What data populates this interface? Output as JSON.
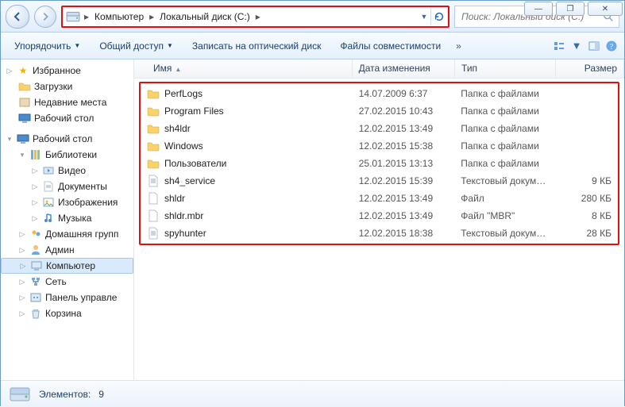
{
  "window_controls": {
    "min": "—",
    "max": "❐",
    "close": "✕"
  },
  "address": {
    "segments": [
      "Компьютер",
      "Локальный диск (C:)"
    ],
    "refresh_title": "Обновить"
  },
  "search": {
    "placeholder": "Поиск: Локальный диск (C:)"
  },
  "commands": {
    "organize": "Упорядочить",
    "share": "Общий доступ",
    "burn": "Записать на оптический диск",
    "compat": "Файлы совместимости"
  },
  "tree": {
    "fav": "Избранное",
    "fav_items": [
      "Загрузки",
      "Недавние места",
      "Рабочий стол"
    ],
    "desktop": "Рабочий стол",
    "libraries": "Библиотеки",
    "lib_items": [
      "Видео",
      "Документы",
      "Изображения",
      "Музыка"
    ],
    "homegroup": "Домашняя групп",
    "admin": "Админ",
    "computer": "Компьютер",
    "network": "Сеть",
    "control": "Панель управле",
    "recycle": "Корзина"
  },
  "columns": {
    "name": "Имя",
    "date": "Дата изменения",
    "type": "Тип",
    "size": "Размер"
  },
  "items": [
    {
      "icon": "folder",
      "name": "PerfLogs",
      "date": "14.07.2009 6:37",
      "type": "Папка с файлами",
      "size": ""
    },
    {
      "icon": "folder",
      "name": "Program Files",
      "date": "27.02.2015 10:43",
      "type": "Папка с файлами",
      "size": ""
    },
    {
      "icon": "folder",
      "name": "sh4ldr",
      "date": "12.02.2015 13:49",
      "type": "Папка с файлами",
      "size": ""
    },
    {
      "icon": "folder",
      "name": "Windows",
      "date": "12.02.2015 15:38",
      "type": "Папка с файлами",
      "size": ""
    },
    {
      "icon": "folder",
      "name": "Пользователи",
      "date": "25.01.2015 13:13",
      "type": "Папка с файлами",
      "size": ""
    },
    {
      "icon": "text",
      "name": "sh4_service",
      "date": "12.02.2015 15:39",
      "type": "Текстовый докум…",
      "size": "9 КБ"
    },
    {
      "icon": "file",
      "name": "shldr",
      "date": "12.02.2015 13:49",
      "type": "Файл",
      "size": "280 КБ"
    },
    {
      "icon": "file",
      "name": "shldr.mbr",
      "date": "12.02.2015 13:49",
      "type": "Файл \"MBR\"",
      "size": "8 КБ"
    },
    {
      "icon": "text",
      "name": "spyhunter",
      "date": "12.02.2015 18:38",
      "type": "Текстовый докум…",
      "size": "28 КБ"
    }
  ],
  "status": {
    "label": "Элементов:",
    "count": "9"
  }
}
